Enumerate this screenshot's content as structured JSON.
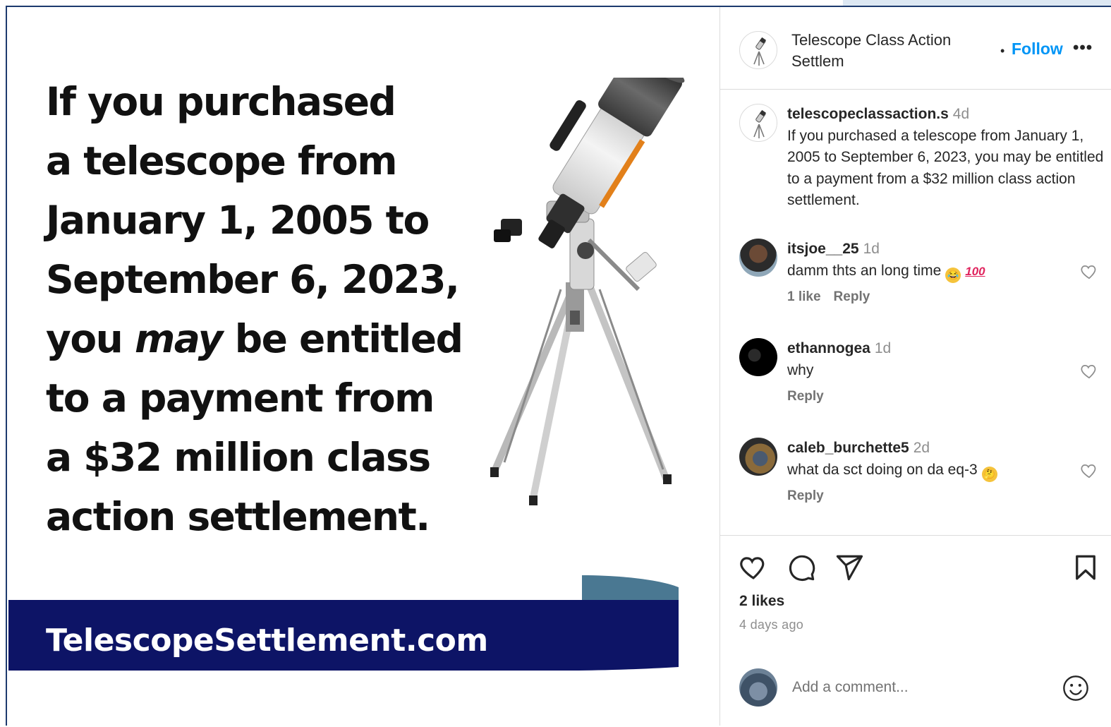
{
  "post_image": {
    "headline_lines": [
      "If you purchased",
      "a telescope from",
      "January 1, 2005 to",
      "September 6, 2023,"
    ],
    "headline_line5_pre": "you ",
    "headline_line5_em": "may",
    "headline_line5_post": " be entitled",
    "headline_lines_end": [
      "to a payment from",
      "a $32 million class",
      "action settlement."
    ],
    "banner_text": "TelescopeSettlement.com",
    "colors": {
      "banner": "#0d1466",
      "banner_accent": "#4a7892"
    }
  },
  "header": {
    "account_name": "Telescope Class Action Settlem",
    "follow_label": "Follow",
    "more_label": "•••",
    "avatar_icon": "telescope-icon"
  },
  "caption": {
    "username": "telescopeclassaction.s",
    "time": "4d",
    "text": "If you purchased a telescope from January 1, 2005 to September 6, 2023, you may be entitled to a payment from a $32 million class action settlement."
  },
  "comments": [
    {
      "username": "itsjoe__25",
      "time": "1d",
      "text": "damm thts an long time",
      "emoji": "laughing-emoji",
      "emoji2": "100",
      "likes": "1 like",
      "reply": "Reply"
    },
    {
      "username": "ethannogea",
      "time": "1d",
      "text": "why",
      "reply": "Reply"
    },
    {
      "username": "caleb_burchette5",
      "time": "2d",
      "text": "what da sct doing on da eq-3",
      "emoji": "thinking-emoji",
      "reply": "Reply"
    }
  ],
  "stats": {
    "likes": "2 likes",
    "posted": "4 days ago"
  },
  "add_comment": {
    "placeholder": "Add a comment..."
  },
  "colors": {
    "link": "#0095f6",
    "text": "#262626",
    "muted": "#8e8e8e",
    "border": "#dbdbdb"
  }
}
